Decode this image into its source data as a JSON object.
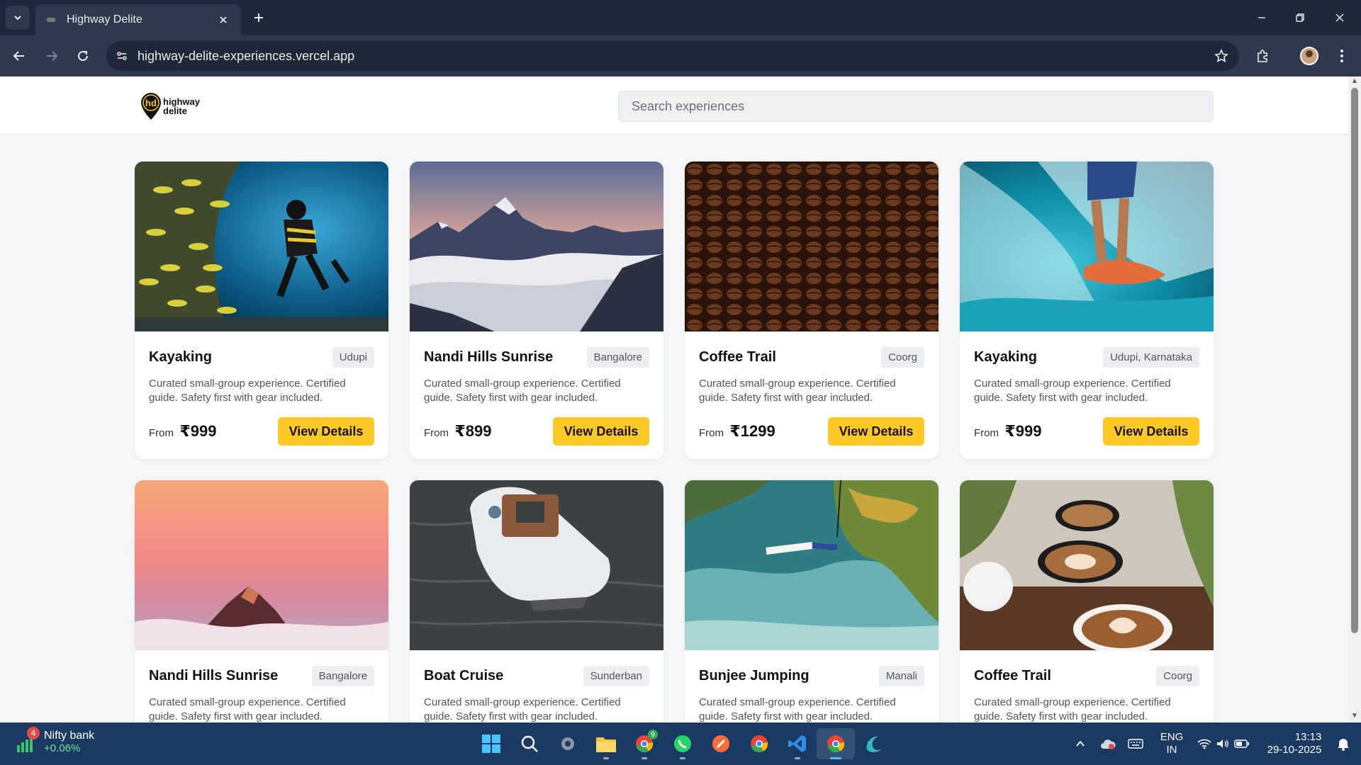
{
  "browser": {
    "tab_title": "Highway Delite",
    "url": "highway-delite-experiences.vercel.app"
  },
  "header": {
    "brand_line1": "highway",
    "brand_line2": "delite",
    "logo_mark": "hd",
    "search_placeholder": "Search experiences"
  },
  "cards": [
    {
      "name": "Kayaking",
      "location": "Udupi",
      "description": "Curated small-group experience. Certified guide. Safety first with gear included.",
      "from": "From",
      "price": "₹999",
      "button": "View Details",
      "image": "scuba-diver-fish-photo"
    },
    {
      "name": "Nandi Hills Sunrise",
      "location": "Bangalore",
      "description": "Curated small-group experience. Certified guide. Safety first with gear included.",
      "from": "From",
      "price": "₹899",
      "button": "View Details",
      "image": "mountains-above-clouds-photo"
    },
    {
      "name": "Coffee Trail",
      "location": "Coorg",
      "description": "Curated small-group experience. Certified guide. Safety first with gear included.",
      "from": "From",
      "price": "₹1299",
      "button": "View Details",
      "image": "coffee-beans-photo"
    },
    {
      "name": "Kayaking",
      "location": "Udupi, Karnataka",
      "description": "Curated small-group experience. Certified guide. Safety first with gear included.",
      "from": "From",
      "price": "₹999",
      "button": "View Details",
      "image": "surfer-wave-photo"
    },
    {
      "name": "Nandi Hills Sunrise",
      "location": "Bangalore",
      "description": "Curated small-group experience. Certified guide. Safety first with gear included.",
      "image": "pink-sky-peak-photo"
    },
    {
      "name": "Boat Cruise",
      "location": "Sunderban",
      "description": "Curated small-group experience. Certified guide. Safety first with gear included.",
      "image": "motor-boat-photo"
    },
    {
      "name": "Bunjee Jumping",
      "location": "Manali",
      "description": "Curated small-group experience. Certified guide. Safety first with gear included.",
      "image": "bungee-over-river-photo"
    },
    {
      "name": "Coffee Trail",
      "location": "Coorg",
      "description": "Curated small-group experience. Certified guide. Safety first with gear included.",
      "image": "latte-cups-photo"
    }
  ],
  "taskbar": {
    "stock_name": "Nifty bank",
    "stock_change": "+0.06%",
    "notification_count": "4",
    "chrome_badge": "9",
    "lang_line1": "ENG",
    "lang_line2": "IN",
    "time": "13:13",
    "date": "29-10-2025"
  },
  "colors": {
    "accent_button": "#fdc824",
    "browser_dark": "#1f2839",
    "taskbar": "#1b3a63"
  }
}
